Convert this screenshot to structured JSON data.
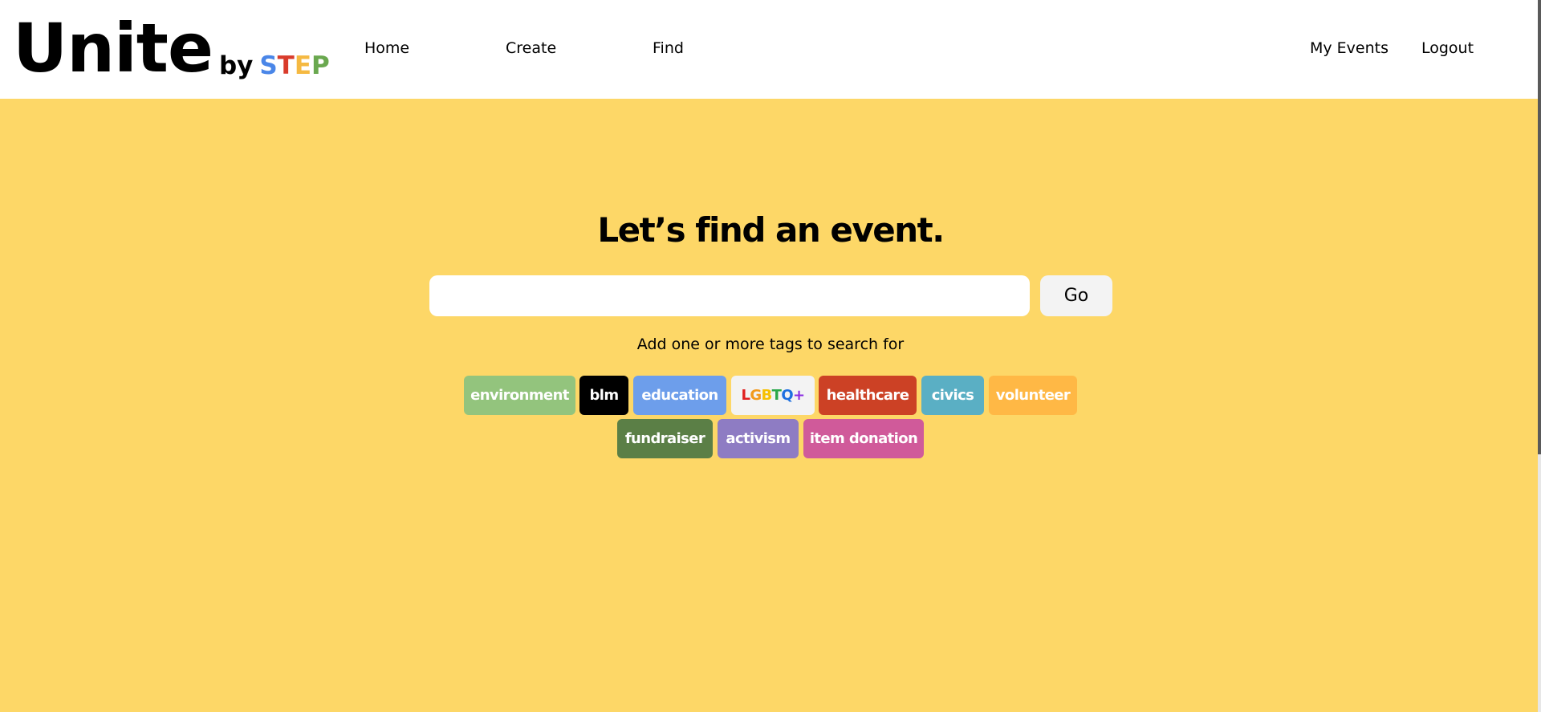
{
  "header": {
    "logo": {
      "main": "Unite",
      "by": "by",
      "step_letters": [
        {
          "char": "S",
          "color": "#4a86e8"
        },
        {
          "char": "T",
          "color": "#d93b2b"
        },
        {
          "char": "E",
          "color": "#f5b942"
        },
        {
          "char": "P",
          "color": "#6aa84f"
        }
      ]
    },
    "nav": {
      "home": "Home",
      "create": "Create",
      "find": "Find",
      "my_events": "My Events",
      "logout": "Logout"
    }
  },
  "main": {
    "heading": "Let’s find an event.",
    "search": {
      "value": "",
      "placeholder": ""
    },
    "go_label": "Go",
    "helper_text": "Add one or more tags to search for",
    "tags": [
      {
        "label": "environment",
        "color": "#93c47d"
      },
      {
        "label": "blm",
        "color": "#000000"
      },
      {
        "label": "education",
        "color": "#6d9eeb"
      },
      {
        "label": "LGBTQ+",
        "color": "#f3f3f3"
      },
      {
        "label": "healthcare",
        "color": "#cc4125"
      },
      {
        "label": "civics",
        "color": "#5aafc4"
      },
      {
        "label": "volunteer",
        "color": "#ffb845"
      },
      {
        "label": "fundraiser",
        "color": "#5b7f46"
      },
      {
        "label": "activism",
        "color": "#8e7cc3"
      },
      {
        "label": "item donation",
        "color": "#d05a9a"
      }
    ],
    "lgbt_colors": [
      "#e02020",
      "#f29a1c",
      "#f6c000",
      "#2aa84a",
      "#1c6fe0",
      "#8a2be2"
    ]
  }
}
